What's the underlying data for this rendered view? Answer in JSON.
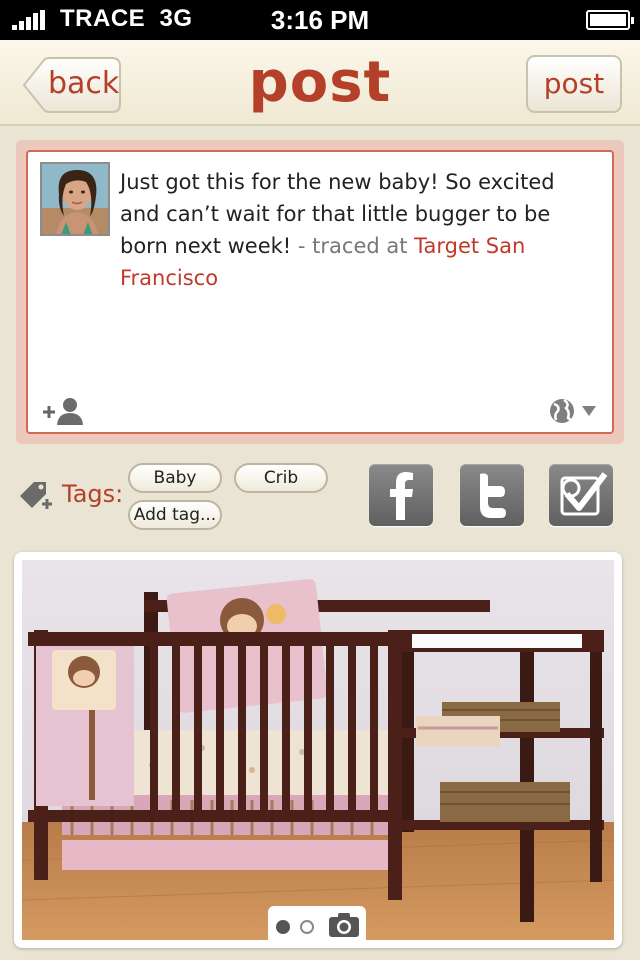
{
  "status_bar": {
    "carrier": "TRACE",
    "network": "3G",
    "time": "3:16 PM"
  },
  "nav": {
    "back_label": "back",
    "title": "post",
    "post_label": "post"
  },
  "composer": {
    "text": "Just got this for the new baby!  So excited and can’t wait for that little bugger to be born next week!",
    "meta_prefix": " - traced at ",
    "place": "Target San Francisco"
  },
  "tags": {
    "label": "Tags:",
    "items": [
      "Baby",
      "Crib"
    ],
    "add_label": "Add tag..."
  },
  "share": [
    {
      "icon": "facebook-icon"
    },
    {
      "icon": "twitter-icon"
    },
    {
      "icon": "check-in-icon"
    }
  ],
  "photo": {
    "pager": {
      "total": 2,
      "current": 1
    },
    "icon": "camera-icon"
  },
  "colors": {
    "accent": "#b5402a",
    "link": "#c0392b",
    "background": "#e9e4d3"
  }
}
